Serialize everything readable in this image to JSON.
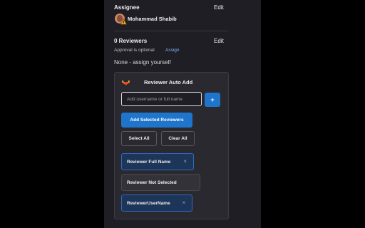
{
  "assignee": {
    "title": "Assignee",
    "edit_label": "Edit",
    "name": "Mohammad Shabib"
  },
  "reviewers": {
    "title": "0 Reviewers",
    "edit_label": "Edit",
    "approval_text": "Approval is optional",
    "assign_link": "Assign",
    "none_text": "None - assign yourself"
  },
  "panel": {
    "title": "Reviewer Auto Add",
    "input_placeholder": "Add username or full name",
    "input_value": "",
    "plus_label": "+",
    "add_selected_label": "Add Selected Reviewers",
    "select_all_label": "Select All",
    "clear_all_label": "Clear All",
    "chips": [
      {
        "label": "Reviewer Full Name",
        "selected": true,
        "remove": "×"
      },
      {
        "label": "Reviewer Not Selected",
        "selected": false,
        "remove": ""
      },
      {
        "label": "ReviewerUserName",
        "selected": true,
        "remove": "×"
      }
    ]
  },
  "colors": {
    "sidebar_bg": "#1f1e24",
    "accent": "#1f75cb",
    "link": "#7fb2ff",
    "chip_selected_bg": "#1c3558",
    "chip_unselected_bg": "#333238"
  },
  "icons": {
    "avatar": "user-avatar",
    "warning": "warning-icon",
    "logo": "gitlab-fox-icon",
    "remove": "close-icon"
  }
}
